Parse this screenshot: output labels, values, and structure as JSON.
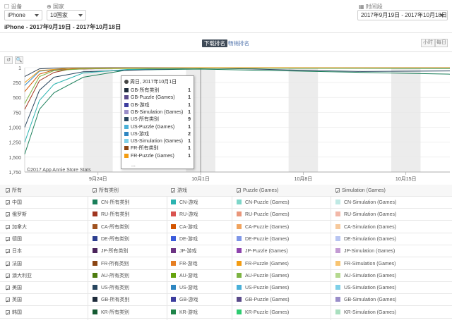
{
  "filters": {
    "device_label": "设备",
    "device_value": "iPhone",
    "country_label": "国家",
    "country_value": "10国家",
    "date_label": "时间段",
    "date_value": "2017年9月19日 - 2017年10月18日"
  },
  "subtitle": "iPhone - 2017年9月19日 - 2017年10月18日",
  "tabs": {
    "downloads": "下载排名",
    "revenue": "畅销排名"
  },
  "granularity": {
    "hourly": "小时",
    "daily": "每日"
  },
  "tools": {
    "undo": "↺",
    "zoom": "🔍"
  },
  "chart_data": {
    "type": "line",
    "watermark": "©2017 App Annie Store Stats",
    "y_ticks": [
      "1",
      "250",
      "500",
      "750",
      "1,000",
      "1,250",
      "1,500",
      "1,750"
    ],
    "ylim": [
      1750,
      1
    ],
    "x_ticks": [
      "9月24日",
      "10月1日",
      "10月8日",
      "10月15日"
    ],
    "x_range": [
      "2017-09-19",
      "2017-10-18"
    ],
    "weekend_bands": true,
    "series": [
      {
        "name": "GB-所有类别",
        "color": "#2c3e50",
        "x": [
          "2017-09-19",
          "2017-09-20",
          "2017-09-21",
          "2017-09-22",
          "2017-09-25",
          "2017-10-01",
          "2017-10-08",
          "2017-10-18"
        ],
        "y": [
          150,
          20,
          8,
          3,
          1,
          1,
          1,
          1
        ]
      },
      {
        "name": "CN-所有类别",
        "color": "#1a7f5a",
        "x": [
          "2017-09-19",
          "2017-09-20",
          "2017-09-21",
          "2017-09-23",
          "2017-09-26",
          "2017-10-01",
          "2017-10-08",
          "2017-10-15",
          "2017-10-18"
        ],
        "y": [
          1450,
          700,
          420,
          160,
          40,
          25,
          60,
          95,
          110
        ]
      },
      {
        "name": "US-所有类别",
        "color": "#27455e",
        "x": [
          "2017-09-19",
          "2017-09-20",
          "2017-09-21",
          "2017-09-23",
          "2017-09-28",
          "2017-10-01",
          "2017-10-04",
          "2017-10-08",
          "2017-10-12",
          "2017-10-18"
        ],
        "y": [
          1000,
          380,
          160,
          70,
          30,
          9,
          20,
          45,
          65,
          55
        ]
      },
      {
        "name": "CN-游戏",
        "color": "#2bb3b0",
        "x": [
          "2017-09-19",
          "2017-09-20",
          "2017-09-21",
          "2017-09-23",
          "2017-09-26",
          "2017-10-01",
          "2017-10-18"
        ],
        "y": [
          1250,
          550,
          280,
          90,
          30,
          10,
          15
        ]
      },
      {
        "name": "RU-所有类别",
        "color": "#a0351f",
        "x": [
          "2017-09-19",
          "2017-09-20",
          "2017-09-21",
          "2017-09-22",
          "2017-09-25",
          "2017-10-01",
          "2017-10-18"
        ],
        "y": [
          700,
          220,
          80,
          30,
          10,
          3,
          5
        ]
      },
      {
        "name": "CA-所有类别",
        "color": "#d35400",
        "x": [
          "2017-09-19",
          "2017-09-20",
          "2017-09-21",
          "2017-09-23",
          "2017-10-01",
          "2017-10-18"
        ],
        "y": [
          400,
          110,
          40,
          15,
          5,
          6
        ]
      },
      {
        "name": "AU-Puzzle (Games)",
        "color": "#7cb342",
        "x": [
          "2017-09-19",
          "2017-09-20",
          "2017-09-21",
          "2017-09-23",
          "2017-10-01",
          "2017-10-18"
        ],
        "y": [
          600,
          150,
          50,
          20,
          8,
          10
        ]
      },
      {
        "name": "US-游戏",
        "color": "#2e86c1",
        "x": [
          "2017-09-19",
          "2017-09-20",
          "2017-09-22",
          "2017-10-01",
          "2017-10-18"
        ],
        "y": [
          300,
          60,
          12,
          2,
          3
        ]
      },
      {
        "name": "FR-Puzzle (Games)",
        "color": "#f39c12",
        "x": [
          "2017-09-19",
          "2017-09-20",
          "2017-09-22",
          "2017-10-01",
          "2017-10-18"
        ],
        "y": [
          250,
          50,
          10,
          1,
          2
        ]
      }
    ]
  },
  "tooltip": {
    "title": "周日, 2017年10月1日",
    "rows": [
      {
        "label": "GB-所有类别",
        "value": "1",
        "color": "#1e2b3a"
      },
      {
        "label": "GB-Puzzle (Games)",
        "value": "1",
        "color": "#5a4a8a"
      },
      {
        "label": "GB-游戏",
        "value": "1",
        "color": "#3d3d9e"
      },
      {
        "label": "GB-Simulation (Games)",
        "value": "1",
        "color": "#9a8ec9"
      },
      {
        "label": "US-所有类别",
        "value": "9",
        "color": "#27455e"
      },
      {
        "label": "US-Puzzle (Games)",
        "value": "1",
        "color": "#4ab0d8"
      },
      {
        "label": "US-游戏",
        "value": "2",
        "color": "#2e86c1"
      },
      {
        "label": "US-Simulation (Games)",
        "value": "1",
        "color": "#7fd0e8"
      },
      {
        "label": "FR-所有类别",
        "value": "1",
        "color": "#8b4513"
      },
      {
        "label": "FR-Puzzle (Games)",
        "value": "1",
        "color": "#f39c12"
      }
    ],
    "more": "..."
  },
  "legend": {
    "headers": [
      "所有",
      "所有类别",
      "游戏",
      "Puzzle (Games)",
      "Simulation (Games)"
    ],
    "rows": [
      {
        "country": "中国",
        "items": [
          {
            "label": "CN-所有类别",
            "color": "#1a7f5a"
          },
          {
            "label": "CN-游戏",
            "color": "#2bb3b0"
          },
          {
            "label": "CN-Puzzle (Games)",
            "color": "#7ed6c9"
          },
          {
            "label": "CN-Simulation (Games)",
            "color": "#bfe9e4"
          }
        ]
      },
      {
        "country": "俄罗斯",
        "items": [
          {
            "label": "RU-所有类别",
            "color": "#a0351f"
          },
          {
            "label": "RU-游戏",
            "color": "#d9534f"
          },
          {
            "label": "RU-Puzzle (Games)",
            "color": "#e9967a"
          },
          {
            "label": "RU-Simulation (Games)",
            "color": "#f2b8a8"
          }
        ]
      },
      {
        "country": "加拿大",
        "items": [
          {
            "label": "CA-所有类别",
            "color": "#a0521f"
          },
          {
            "label": "CA-游戏",
            "color": "#d35400"
          },
          {
            "label": "CA-Puzzle (Games)",
            "color": "#f0a35e"
          },
          {
            "label": "CA-Simulation (Games)",
            "color": "#f7c99c"
          }
        ]
      },
      {
        "country": "德国",
        "items": [
          {
            "label": "DE-所有类别",
            "color": "#2c3e8f"
          },
          {
            "label": "DE-游戏",
            "color": "#3b5bdb"
          },
          {
            "label": "DE-Puzzle (Games)",
            "color": "#7f96e8"
          },
          {
            "label": "DE-Simulation (Games)",
            "color": "#b8c5f2"
          }
        ]
      },
      {
        "country": "日本",
        "items": [
          {
            "label": "JP-所有类别",
            "color": "#4a235a"
          },
          {
            "label": "JP-游戏",
            "color": "#6c3483"
          },
          {
            "label": "JP-Puzzle (Games)",
            "color": "#8e44ad"
          },
          {
            "label": "JP-Simulation (Games)",
            "color": "#c39bd3"
          }
        ]
      },
      {
        "country": "法国",
        "items": [
          {
            "label": "FR-所有类别",
            "color": "#8b4513"
          },
          {
            "label": "FR-游戏",
            "color": "#e67e22"
          },
          {
            "label": "FR-Puzzle (Games)",
            "color": "#f39c12"
          },
          {
            "label": "FR-Simulation (Games)",
            "color": "#f8c471"
          }
        ]
      },
      {
        "country": "澳大利亚",
        "items": [
          {
            "label": "AU-所有类别",
            "color": "#4d7c0f"
          },
          {
            "label": "AU-游戏",
            "color": "#65a30d"
          },
          {
            "label": "AU-Puzzle (Games)",
            "color": "#7cb342"
          },
          {
            "label": "AU-Simulation (Games)",
            "color": "#b5d98f"
          }
        ]
      },
      {
        "country": "美国",
        "items": [
          {
            "label": "US-所有类别",
            "color": "#27455e"
          },
          {
            "label": "US-游戏",
            "color": "#2e86c1"
          },
          {
            "label": "US-Puzzle (Games)",
            "color": "#4ab0d8"
          },
          {
            "label": "US-Simulation (Games)",
            "color": "#7fd0e8"
          }
        ]
      },
      {
        "country": "英国",
        "items": [
          {
            "label": "GB-所有类别",
            "color": "#1e2b3a"
          },
          {
            "label": "GB-游戏",
            "color": "#3d3d9e"
          },
          {
            "label": "GB-Puzzle (Games)",
            "color": "#5a4a8a"
          },
          {
            "label": "GB-Simulation (Games)",
            "color": "#9a8ec9"
          }
        ]
      },
      {
        "country": "韩国",
        "items": [
          {
            "label": "KR-所有类别",
            "color": "#145a32"
          },
          {
            "label": "KR-游戏",
            "color": "#1e8449"
          },
          {
            "label": "KR-Puzzle (Games)",
            "color": "#2ecc71"
          },
          {
            "label": "KR-Simulation (Games)",
            "color": "#a9dfbf"
          }
        ]
      }
    ]
  }
}
